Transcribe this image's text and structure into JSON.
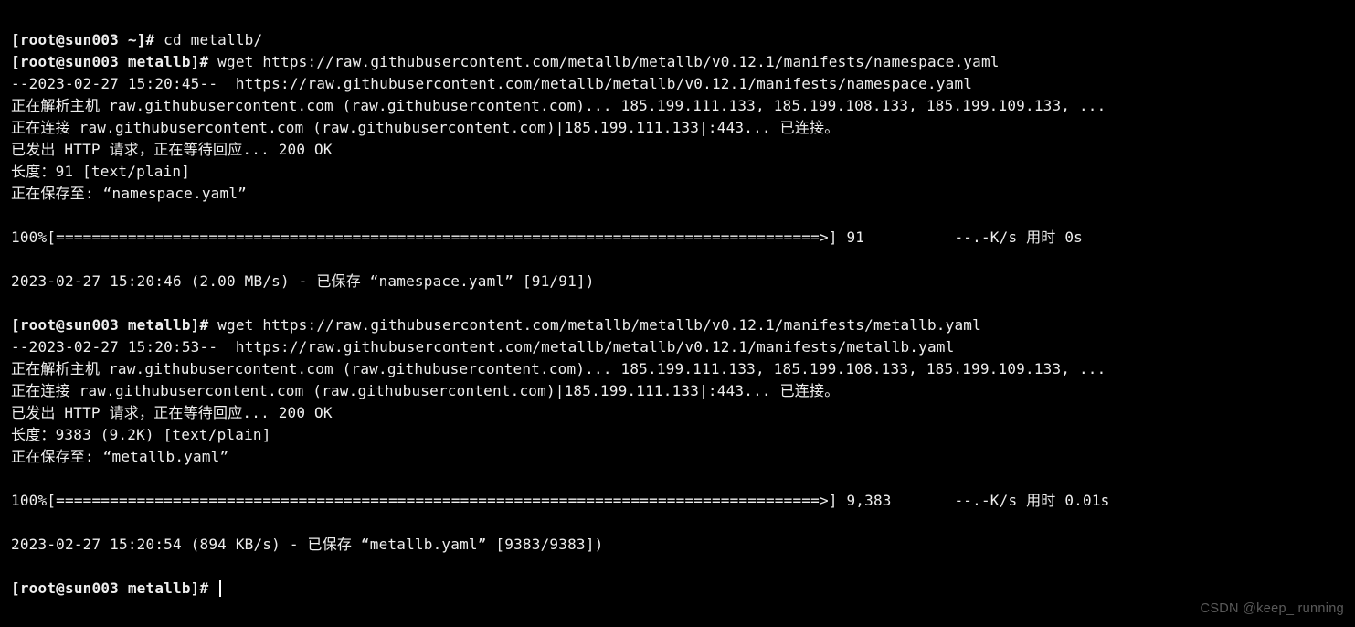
{
  "prompt1": "[root@sun003 ~]# ",
  "cmd1": "cd metallb/",
  "prompt2": "[root@sun003 metallb]# ",
  "cmd2": "wget https://raw.githubusercontent.com/metallb/metallb/v0.12.1/manifests/namespace.yaml",
  "l03": "--2023-02-27 15:20:45--  https://raw.githubusercontent.com/metallb/metallb/v0.12.1/manifests/namespace.yaml",
  "l04": "正在解析主机 raw.githubusercontent.com (raw.githubusercontent.com)... 185.199.111.133, 185.199.108.133, 185.199.109.133, ...",
  "l05": "正在连接 raw.githubusercontent.com (raw.githubusercontent.com)|185.199.111.133|:443... 已连接。",
  "l06": "已发出 HTTP 请求，正在等待回应... 200 OK",
  "l07": "长度：91 [text/plain]",
  "l08": "正在保存至: “namespace.yaml”",
  "l09": "",
  "l10": "100%[=====================================================================================>] 91          --.-K/s 用时 0s",
  "l11": "",
  "l12": "2023-02-27 15:20:46 (2.00 MB/s) - 已保存 “namespace.yaml” [91/91])",
  "l13": "",
  "prompt3": "[root@sun003 metallb]# ",
  "cmd3": "wget https://raw.githubusercontent.com/metallb/metallb/v0.12.1/manifests/metallb.yaml",
  "l15": "--2023-02-27 15:20:53--  https://raw.githubusercontent.com/metallb/metallb/v0.12.1/manifests/metallb.yaml",
  "l16": "正在解析主机 raw.githubusercontent.com (raw.githubusercontent.com)... 185.199.111.133, 185.199.108.133, 185.199.109.133, ...",
  "l17": "正在连接 raw.githubusercontent.com (raw.githubusercontent.com)|185.199.111.133|:443... 已连接。",
  "l18": "已发出 HTTP 请求，正在等待回应... 200 OK",
  "l19": "长度：9383 (9.2K) [text/plain]",
  "l20": "正在保存至: “metallb.yaml”",
  "l21": "",
  "l22": "100%[=====================================================================================>] 9,383       --.-K/s 用时 0.01s",
  "l23": "",
  "l24": "2023-02-27 15:20:54 (894 KB/s) - 已保存 “metallb.yaml” [9383/9383])",
  "l25": "",
  "prompt4": "[root@sun003 metallb]# ",
  "watermark": "CSDN @keep_ running"
}
